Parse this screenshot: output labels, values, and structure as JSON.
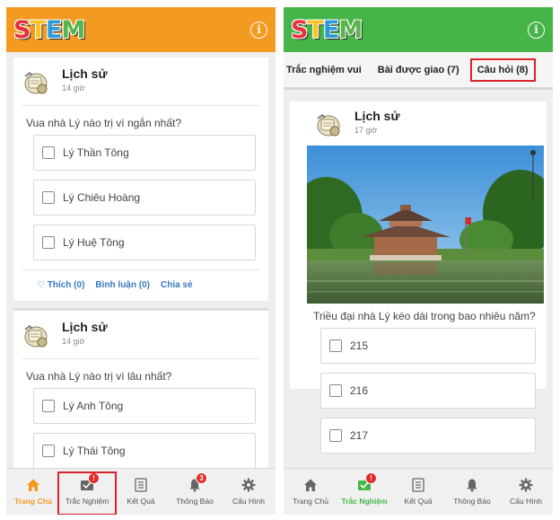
{
  "brand": {
    "logo_letters": [
      "S",
      "T",
      "E",
      "M"
    ],
    "logo_colors": [
      "#e8333b",
      "#f7c325",
      "#2f9ad8",
      "#58b44b"
    ],
    "info_icon": "i"
  },
  "left": {
    "header_color": "#f39a21",
    "posts": [
      {
        "subject": "Lịch sử",
        "time": "14 giờ",
        "question": "Vua nhà Lý nào trị vì ngắn nhất?",
        "options": [
          "Lý Thần Tông",
          "Lý Chiêu Hoàng",
          "Lý Huệ Tông"
        ],
        "like": "♡ Thích (0)",
        "comment": "Bình luận (0)",
        "share": "Chia sẻ"
      },
      {
        "subject": "Lịch sử",
        "time": "14 giờ",
        "question": "Vua nhà Lý nào trị vì lâu nhất?",
        "options": [
          "Lý Anh Tông",
          "Lý Thái Tông"
        ]
      }
    ],
    "nav": [
      {
        "label": "Trang Chủ",
        "icon": "home-icon",
        "state": "active"
      },
      {
        "label": "Trắc Nghiệm",
        "icon": "quiz-icon",
        "badge": "!"
      },
      {
        "label": "Kết Quả",
        "icon": "results-icon"
      },
      {
        "label": "Thông Báo",
        "icon": "bell-icon",
        "badge": "3"
      },
      {
        "label": "Cấu Hình",
        "icon": "gear-icon"
      }
    ]
  },
  "right": {
    "header_color": "#46b549",
    "tabs": [
      "Trắc nghiệm vui",
      "Bài được giao (7)",
      "Câu hỏi (8)"
    ],
    "active_tab": "Câu hỏi (8)",
    "post": {
      "subject": "Lịch sử",
      "time": "17 giờ",
      "image": "pagoda-photo",
      "question": "Triều đại nhà Lý kéo dài trong bao nhiêu năm?",
      "options": [
        "215",
        "216",
        "217"
      ]
    },
    "nav": [
      {
        "label": "Trang Chủ",
        "icon": "home-icon"
      },
      {
        "label": "Trắc Nghiệm",
        "icon": "quiz-icon",
        "badge": "!",
        "state": "active"
      },
      {
        "label": "Kết Quả",
        "icon": "results-icon"
      },
      {
        "label": "Thông Báo",
        "icon": "bell-icon"
      },
      {
        "label": "Cấu Hình",
        "icon": "gear-icon"
      }
    ]
  }
}
